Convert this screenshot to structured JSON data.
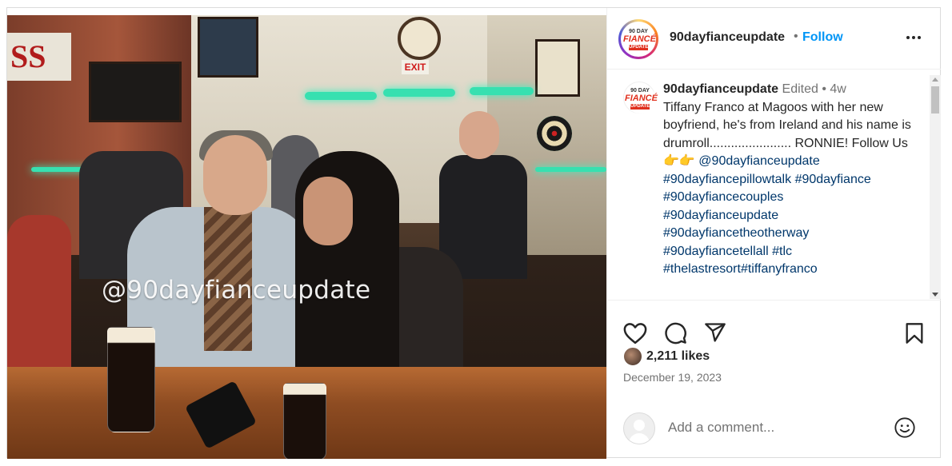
{
  "post": {
    "photo": {
      "watermark": "@90dayfianceupdate",
      "signs": {
        "ss": "SS",
        "exit": "EXIT"
      }
    },
    "header": {
      "username": "90dayfianceupdate",
      "separator": "•",
      "follow_label": "Follow",
      "avatar_logo": {
        "line1": "90 DAY",
        "line2": "FIANCÉ",
        "line3": "UPDATE"
      }
    },
    "caption": {
      "username": "90dayfianceupdate",
      "edited": "Edited",
      "separator": "•",
      "age": "4w",
      "text": "Tiffany Franco at Magoos with her new boyfriend, he's from Ireland and his name is drumroll....................... RONNIE! Follow Us",
      "emoji": "👉👉",
      "mention": "@90dayfianceupdate",
      "hashtags": [
        "#90dayfiancepillowtalk",
        "#90dayfiance",
        "#90dayfiancecouples",
        "#90dayfianceupdate",
        "#90dayfiancetheotherway",
        "#90dayfiancetellall",
        "#tlc",
        "#thelastresort#tiffanyfranco"
      ]
    },
    "actions": {
      "icons": [
        "heart-icon",
        "comment-icon",
        "share-icon",
        "bookmark-icon"
      ],
      "likes": "2,211 likes",
      "date": "December 19, 2023"
    },
    "comment": {
      "placeholder": "Add a comment...",
      "emoji_icon": "smiley-icon"
    },
    "colors": {
      "link": "#0095f6",
      "hashtag": "#00376b",
      "muted": "#737373",
      "text": "#262626"
    }
  }
}
